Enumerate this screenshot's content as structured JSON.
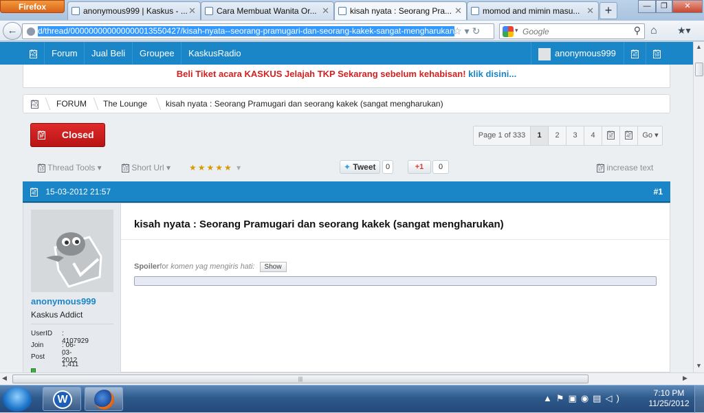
{
  "browser": {
    "menu_button": "Firefox",
    "tabs": [
      {
        "label": "anonymous999 | Kaskus - ...",
        "active": false
      },
      {
        "label": "Cara Membuat Wanita Or...",
        "active": false
      },
      {
        "label": "kisah nyata : Seorang Pra...",
        "active": true
      },
      {
        "label": "momod and mimin masu...",
        "active": false
      }
    ],
    "new_tab": "+",
    "url": "d/thread/000000000000000013550427/kisah-nyata--seorang-pramugari-dan-seorang-kakek-sangat-mengharukan",
    "search_placeholder": "Google",
    "window_minimize": "—",
    "window_maximize": "❐",
    "window_close": "✕"
  },
  "site": {
    "nav_items": [
      "Forum",
      "Jual Beli",
      "Groupee",
      "KaskusRadio"
    ],
    "username": "anonymous999",
    "announcement_text": "Beli Tiket acara KASKUS Jelajah TKP Sekarang sebelum kehabisan!",
    "announcement_link": "klik disini...",
    "breadcrumb": [
      "FORUM",
      "The Lounge",
      "kisah nyata : Seorang Pramugari dan seorang kakek (sangat mengharukan)"
    ],
    "closed_label": "Closed",
    "pager": {
      "label": "Page 1 of 333",
      "pages": [
        "1",
        "2",
        "3",
        "4"
      ],
      "go": "Go"
    },
    "thread_tools": "Thread Tools",
    "short_url": "Short Url",
    "tweet": "Tweet",
    "tweet_count": "0",
    "gplus": "+1",
    "gplus_count": "0",
    "increase_text": "increase text",
    "post": {
      "date": "15-03-2012 21:57",
      "number": "#1",
      "title": "kisah nyata : Seorang Pramugari dan seorang kakek (sangat mengharukan)",
      "spoiler_label": "Spoiler",
      "spoiler_for": "for",
      "spoiler_text": "komen yag mengiris hati:",
      "show_button": "Show"
    },
    "author": {
      "name": "anonymous999",
      "title": "Kaskus Addict",
      "fields": [
        {
          "label": "UserID",
          "value": ": 4107929"
        },
        {
          "label": "Join",
          "value": ": 06-03-2012"
        },
        {
          "label": "Post",
          "value": ": 1,411"
        }
      ]
    }
  },
  "taskbar": {
    "time": "7:10 PM",
    "date": "11/25/2012"
  }
}
